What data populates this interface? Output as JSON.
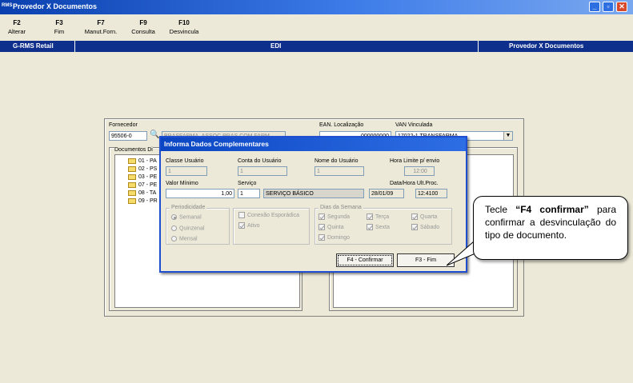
{
  "window": {
    "logo_text": "RMS",
    "title": "Provedor X Documentos",
    "controls": [
      "_",
      "▫",
      "✕"
    ]
  },
  "toolbar": {
    "keys": [
      {
        "key": "F2",
        "label": "Alterar"
      },
      {
        "key": "F3",
        "label": "Fim"
      },
      {
        "key": "F7",
        "label": "Manut.Forn."
      },
      {
        "key": "F9",
        "label": "Consulta"
      },
      {
        "key": "F10",
        "label": "Desvincula"
      }
    ]
  },
  "strip": {
    "left": "G-RMS Retail",
    "center": "EDI",
    "right": "Provedor X Documentos"
  },
  "form": {
    "fornecedor_label": "Fornecedor",
    "fornecedor_code": "95506-0",
    "fornecedor_name": "BRASFARMA. ASSOC.PRAS.COM.FARM",
    "ean_label": "EAN. Localização",
    "ean_value": "000000000",
    "van_label": "VAN Vinculada",
    "van_value": "17022-1 TRANSFARMA",
    "docs_label": "Documentos Di",
    "tree": [
      "01 - PA",
      "02 - PS",
      "03 - PE",
      "07 - PE",
      "08 - TA",
      "09 - PR"
    ]
  },
  "dialog": {
    "title": "Informa Dados Complementares",
    "classe_label": "Classe Usuário",
    "classe_value": "1",
    "conta_label": "Conta do Usuário",
    "conta_value": "1",
    "nome_label": "Nome do Usuário",
    "nome_value": "1",
    "hora_label": "Hora Limite p/ envio",
    "hora_value": "12:00",
    "valor_label": "Valor Mínimo",
    "valor_value": "1,00",
    "servico_label": "Serviço",
    "servico_code": "1",
    "servico_desc": "SERVIÇO BÁSICO",
    "data_label": "Data/Hora Ult.Proc.",
    "data_value": "28/01/09",
    "hora_ult_value": "12:4100",
    "periodicidade_title": "Periodicidade",
    "periodicidade": [
      "Semanal",
      "Quinzenal",
      "Mensal"
    ],
    "conexao_label": "Conexão Esporádica",
    "ativo_label": "Ativo",
    "dias_title": "Dias da Semana",
    "dias": [
      "Segunda",
      "Terça",
      "Quarta",
      "Quinta",
      "Sexta",
      "Sábado",
      "Domingo"
    ],
    "btn_confirmar": "F4 - Confirmar",
    "btn_fim": "F3 - Fim"
  },
  "callout": {
    "prefix": "Tecle",
    "key": "“F4 confirmar”",
    "rest": "para confirmar a desvinculação do tipo de documento."
  }
}
